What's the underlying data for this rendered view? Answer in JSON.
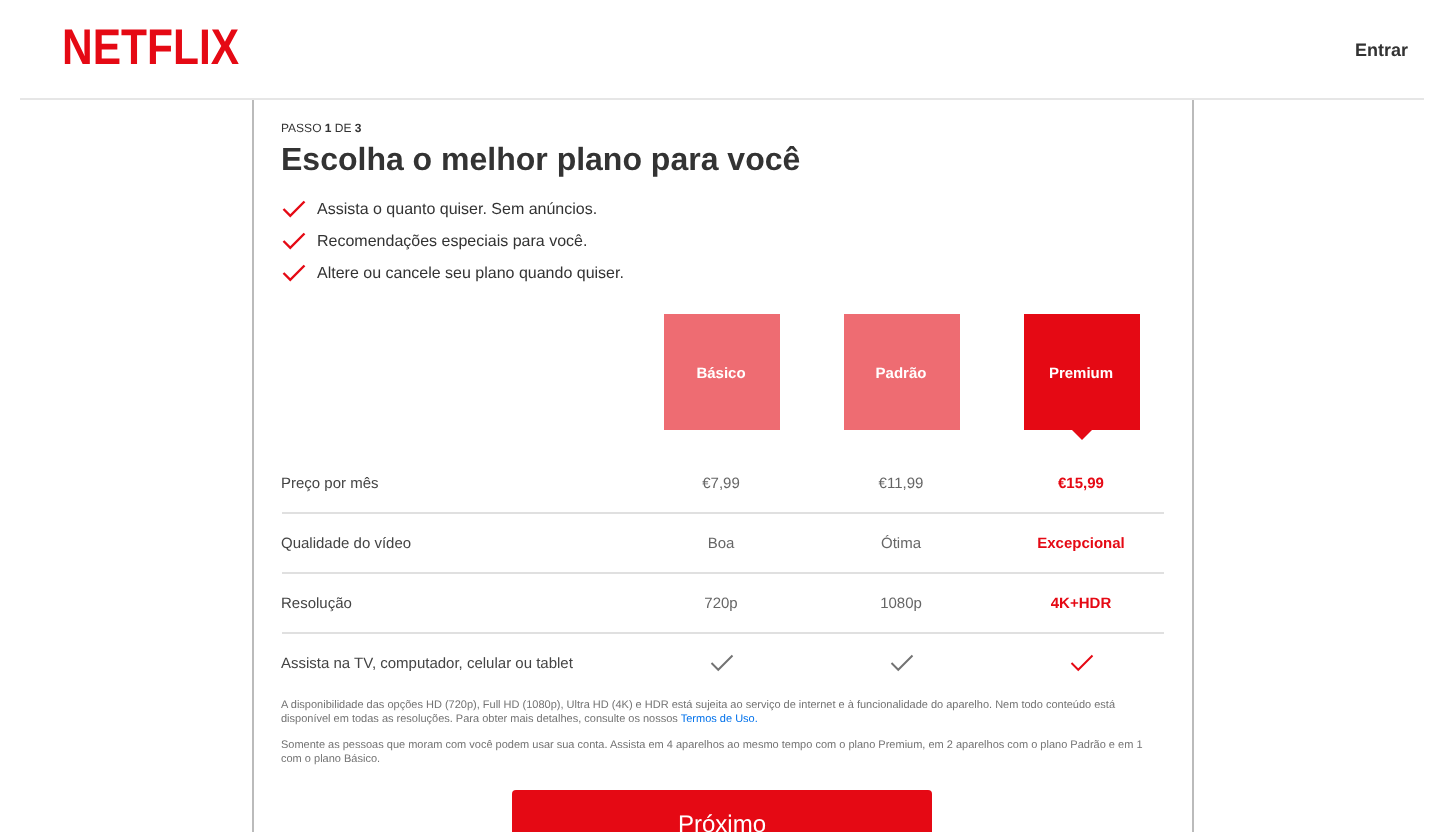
{
  "header": {
    "logo": "NETFLIX",
    "sign_in": "Entrar"
  },
  "step": "PASSO **1** DE **3**",
  "title": "Escolha o melhor plano para você",
  "benefits": [
    "Assista o quanto quiser. Sem anúncios.",
    "Recomendações especiais para você.",
    "Altere ou cancele seu plano quando quiser."
  ],
  "plans": [
    {
      "name": "Básico",
      "selected": false
    },
    {
      "name": "Padrão",
      "selected": false
    },
    {
      "name": "Premium",
      "selected": true
    }
  ],
  "rows": [
    {
      "kind": "text",
      "label": "Preço por mês",
      "values": [
        "€7,99",
        "€11,99",
        "€15,99"
      ]
    },
    {
      "kind": "text",
      "label": "Qualidade do vídeo",
      "values": [
        "Boa",
        "Ótima",
        "Excepcional"
      ]
    },
    {
      "kind": "text",
      "label": "Resolução",
      "values": [
        "720p",
        "1080p",
        "4K+HDR"
      ]
    },
    {
      "kind": "check",
      "label": "Assista na TV, computador, celular ou tablet"
    }
  ],
  "footnotes": [
    {
      "text": "A disponibilidade das opções HD (720p), Full HD (1080p), Ultra HD (4K) e HDR está sujeita ao serviço de internet e à funcionalidade do aparelho. Nem todo conteúdo está disponível em todas as resoluções. Para obter mais detalhes, consulte os nossos",
      "link": "Termos de Uso."
    },
    {
      "text": "Somente as pessoas que moram com você podem usar sua conta. Assista em 4 aparelhos ao mesmo tempo com o plano Premium, em 2 aparelhos com o plano Padrão e em 1 com o plano Básico."
    }
  ],
  "next_button": "Próximo"
}
